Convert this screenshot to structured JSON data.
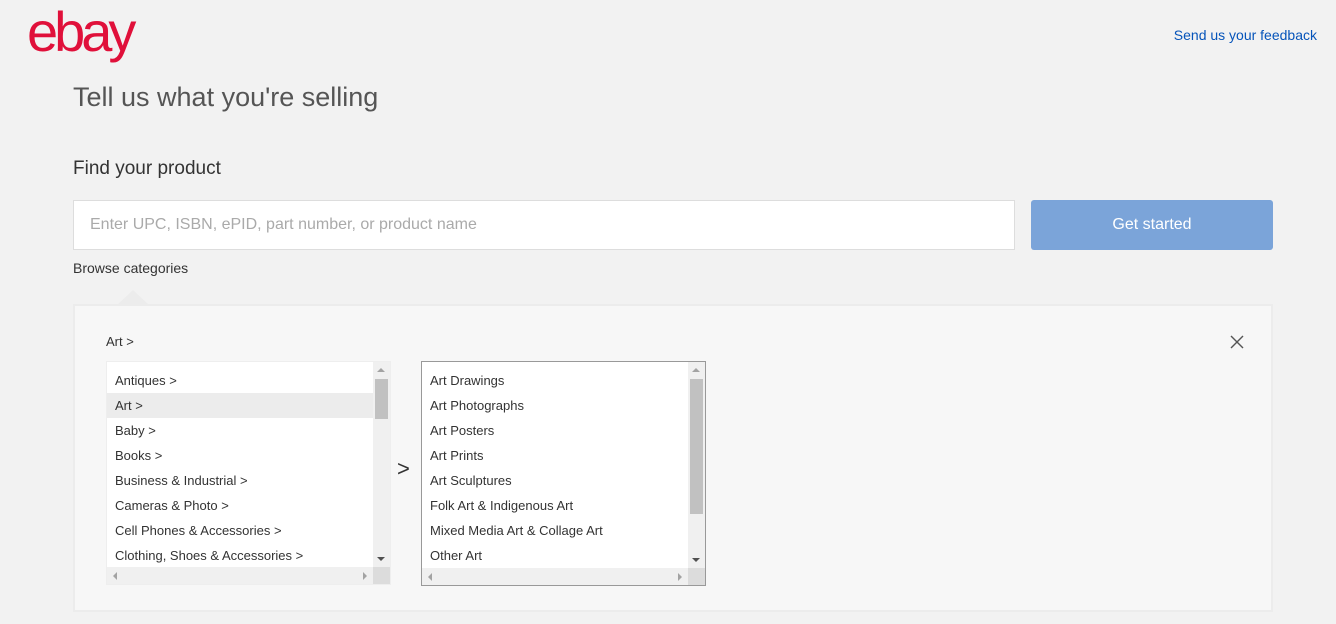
{
  "header": {
    "logo_text": "ebay",
    "feedback_link": "Send us your feedback"
  },
  "page_title": "Tell us what you're selling",
  "find_product": {
    "title": "Find your product",
    "search_placeholder": "Enter UPC, ISBN, ePID, part number, or product name",
    "search_value": "",
    "get_started_label": "Get started",
    "browse_categories_label": "Browse categories"
  },
  "category_browser": {
    "breadcrumb": "Art >",
    "close_icon": "close-icon",
    "separator": ">",
    "level1": {
      "selected_index": 1,
      "items": [
        "Antiques >",
        "Art >",
        "Baby >",
        "Books >",
        "Business & Industrial >",
        "Cameras & Photo >",
        "Cell Phones & Accessories >",
        "Clothing, Shoes & Accessories >"
      ]
    },
    "level2": {
      "items": [
        "Art Drawings",
        "Art Photographs",
        "Art Posters",
        "Art Prints",
        "Art Sculptures",
        "Folk Art & Indigenous Art",
        "Mixed Media Art & Collage Art",
        "Other Art"
      ]
    }
  },
  "colors": {
    "brand": "#e0103a",
    "link": "#0654ba",
    "button_disabled": "#7ba4d9"
  }
}
